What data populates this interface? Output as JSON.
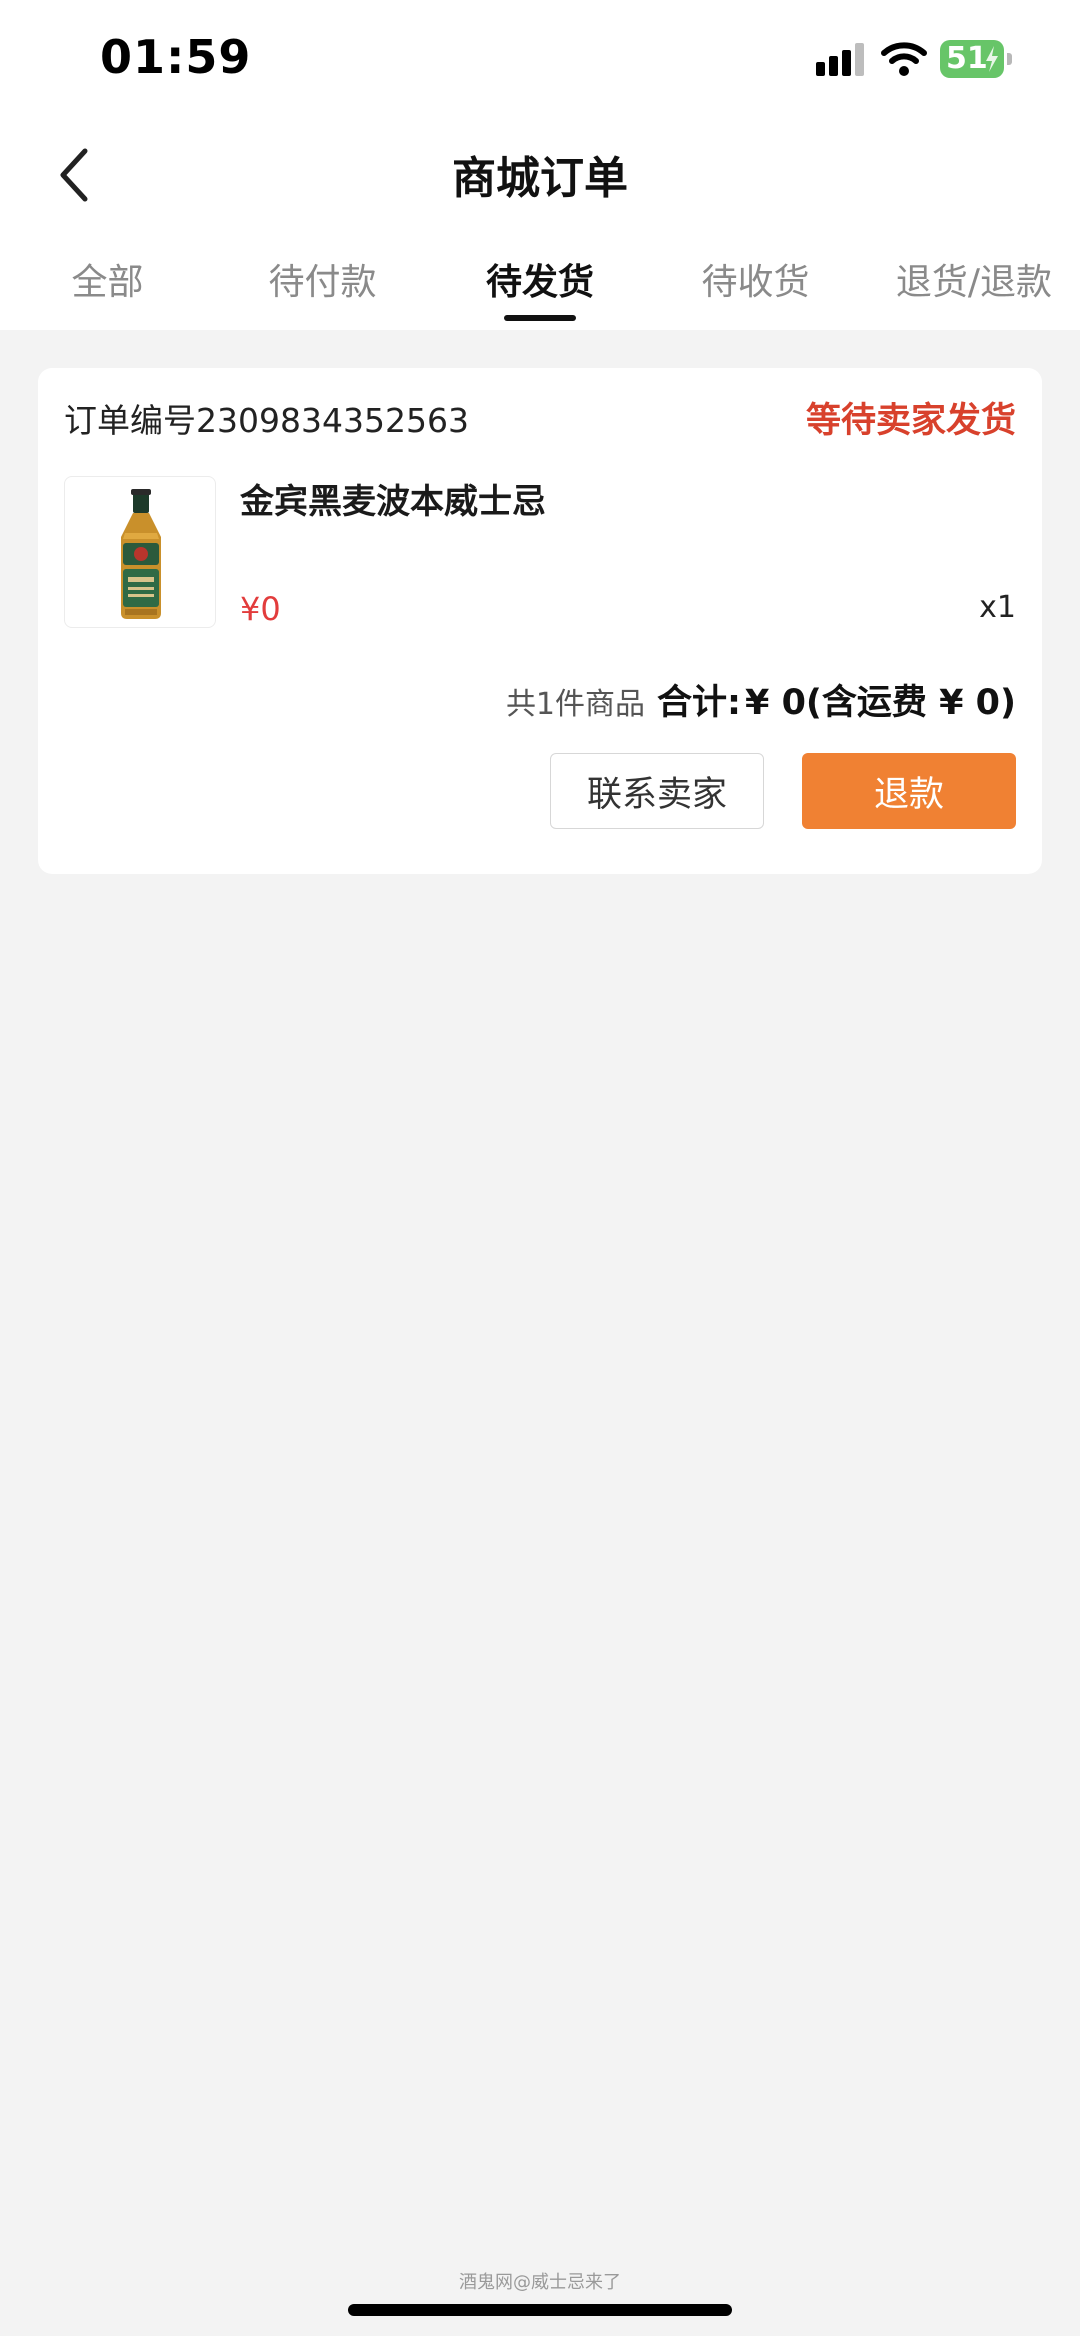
{
  "status_bar": {
    "time": "01:59",
    "battery_level": "51",
    "icons": [
      "signal-icon",
      "wifi-icon",
      "battery-charging-icon"
    ],
    "battery_color": "#67c568"
  },
  "nav": {
    "back_icon": "chevron-left-icon",
    "title": "商城订单"
  },
  "tabs": [
    {
      "label": "全部",
      "active": false
    },
    {
      "label": "待付款",
      "active": false
    },
    {
      "label": "待发货",
      "active": true
    },
    {
      "label": "待收货",
      "active": false
    },
    {
      "label": "退货/退款",
      "active": false
    }
  ],
  "order": {
    "number_label": "订单编号2309834352563",
    "status": "等待卖家发货",
    "product": {
      "name": "金宾黑麦波本威士忌",
      "price": "¥0",
      "quantity": "x1",
      "image_icon": "whiskey-bottle-icon"
    },
    "summary": {
      "count": "共1件商品",
      "total_label": "合计:",
      "total_value": "¥ 0(含运费 ¥ 0)"
    },
    "buttons": {
      "contact_seller": "联系卖家",
      "refund": "退款"
    }
  },
  "colors": {
    "status_red": "#d8412c",
    "price_red": "#e23c3c",
    "refund_orange": "#f08133",
    "background": "#f3f3f3"
  },
  "watermark": "酒鬼网@威士忌来了"
}
